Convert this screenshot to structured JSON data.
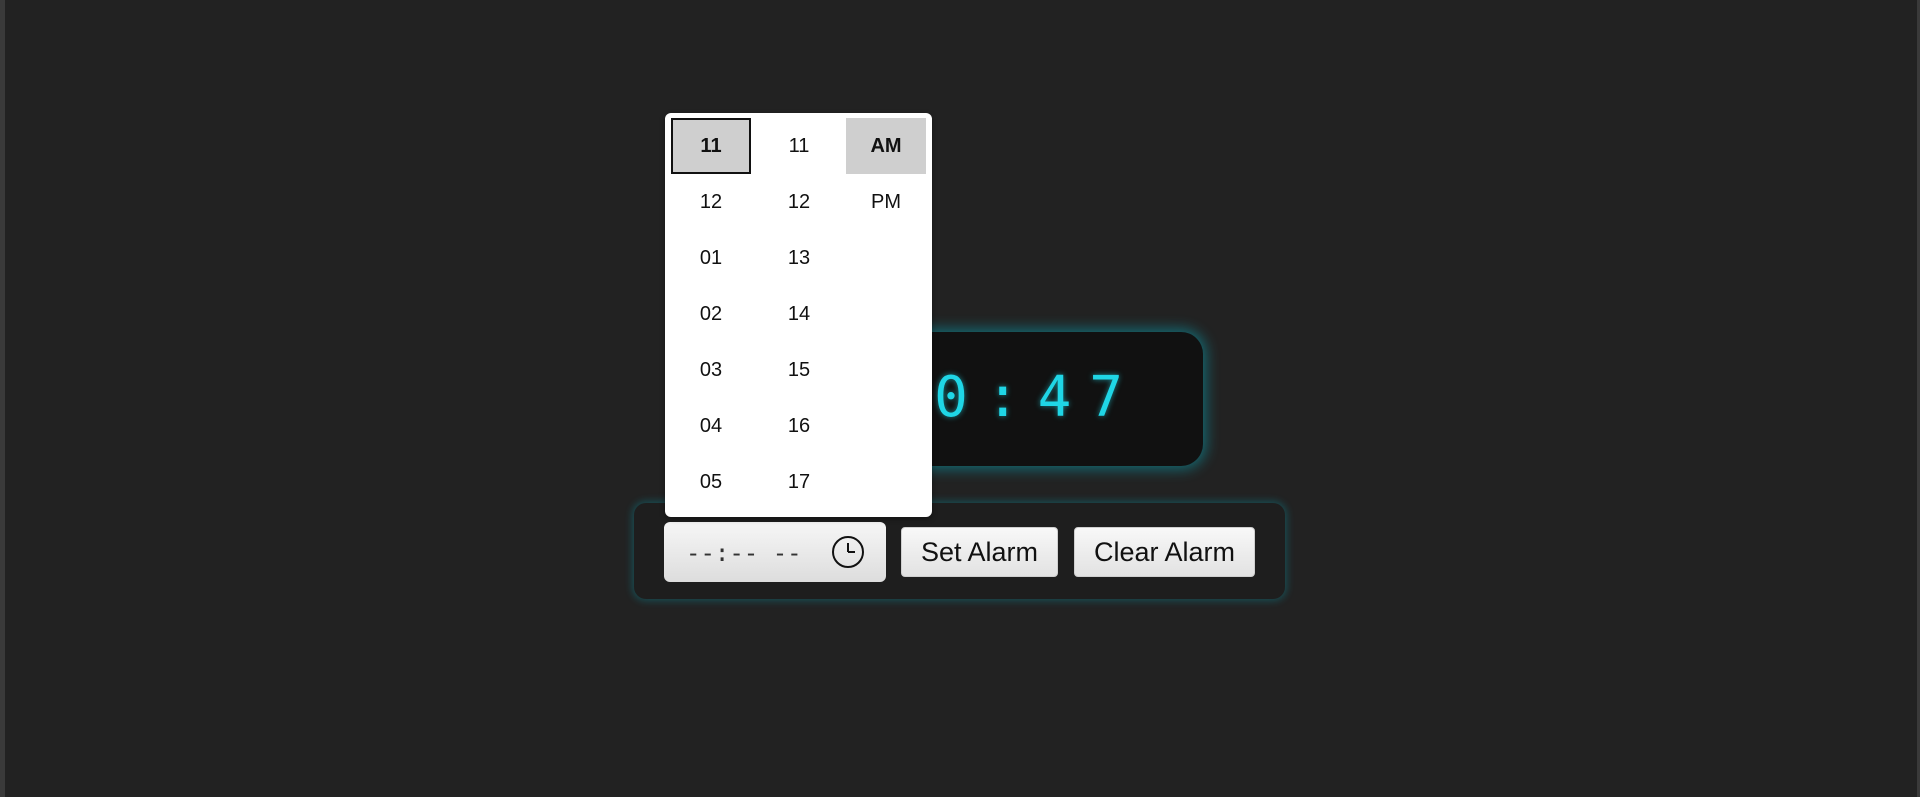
{
  "clock": {
    "time_visible": "10:47"
  },
  "alarm_input": {
    "value_display": "--:-- --",
    "icon": "clock-icon"
  },
  "buttons": {
    "set_alarm": "Set Alarm",
    "clear_alarm": "Clear Alarm"
  },
  "picker": {
    "hours": [
      "11",
      "12",
      "01",
      "02",
      "03",
      "04",
      "05"
    ],
    "minutes": [
      "11",
      "12",
      "13",
      "14",
      "15",
      "16",
      "17"
    ],
    "ampm": [
      "AM",
      "PM"
    ],
    "selected_hour": "11",
    "selected_minute": "11",
    "selected_ampm": "AM"
  },
  "colors": {
    "background": "#222222",
    "clock_digits": "#1fd6e6",
    "clock_glow": "#00c8dc",
    "selected_cell": "#cfcfcf"
  }
}
